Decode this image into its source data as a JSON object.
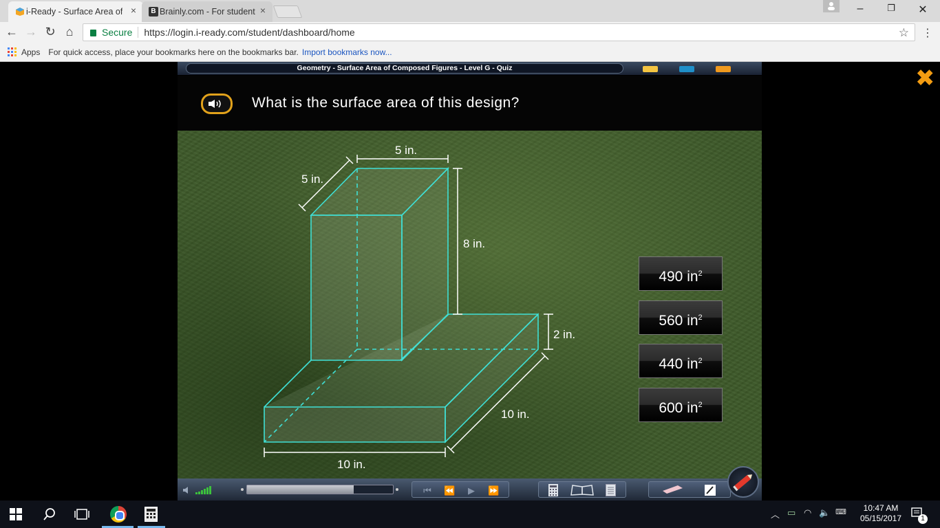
{
  "browser": {
    "tabs": [
      {
        "title": "i-Ready - Surface Area of",
        "close": "×"
      },
      {
        "title": "Brainly.com - For student",
        "close": "×"
      }
    ],
    "nav": {
      "back": "←",
      "forward": "→",
      "reload": "↻",
      "home": "⌂"
    },
    "security": "Secure",
    "url": "https://login.i-ready.com/student/dashboard/home",
    "bookmarks": {
      "apps": "Apps",
      "hint": "For quick access, place your bookmarks here on the bookmarks bar.",
      "import": "Import bookmarks now..."
    },
    "window_controls": {
      "minimize": "–",
      "restore": "❐",
      "close": "✕"
    }
  },
  "lesson": {
    "title": "Geometry - Surface Area of Composed Figures - Level G - Quiz",
    "question": "What is the surface area of this design?",
    "audio_icon": "speaker-icon",
    "close_icon": "close-icon",
    "header_pill_colors": [
      "#f4c542",
      "#1f8fc8",
      "#f09a1e"
    ]
  },
  "figure": {
    "labels": {
      "top_width": "5 in.",
      "depth": "5 in.",
      "height": "8 in.",
      "base_height": "2 in.",
      "base_depth": "10 in.",
      "base_width": "10 in."
    },
    "edge_color": "#3fe0d6"
  },
  "answers": [
    {
      "value": "490 in",
      "exp": "2"
    },
    {
      "value": "560 in",
      "exp": "2"
    },
    {
      "value": "440 in",
      "exp": "2"
    },
    {
      "value": "600 in",
      "exp": "2"
    }
  ],
  "player": {
    "seek_progress": 0.73,
    "icons": [
      "volume-icon",
      "skip-back-icon",
      "rewind-icon",
      "play-icon",
      "fast-forward-icon",
      "calculator-icon",
      "glossary-icon",
      "notes-icon",
      "eraser-icon",
      "highlighter-icon",
      "pen-icon"
    ]
  },
  "taskbar": {
    "clock_time": "10:47 AM",
    "clock_date": "05/15/2017",
    "notification_count": "1"
  }
}
